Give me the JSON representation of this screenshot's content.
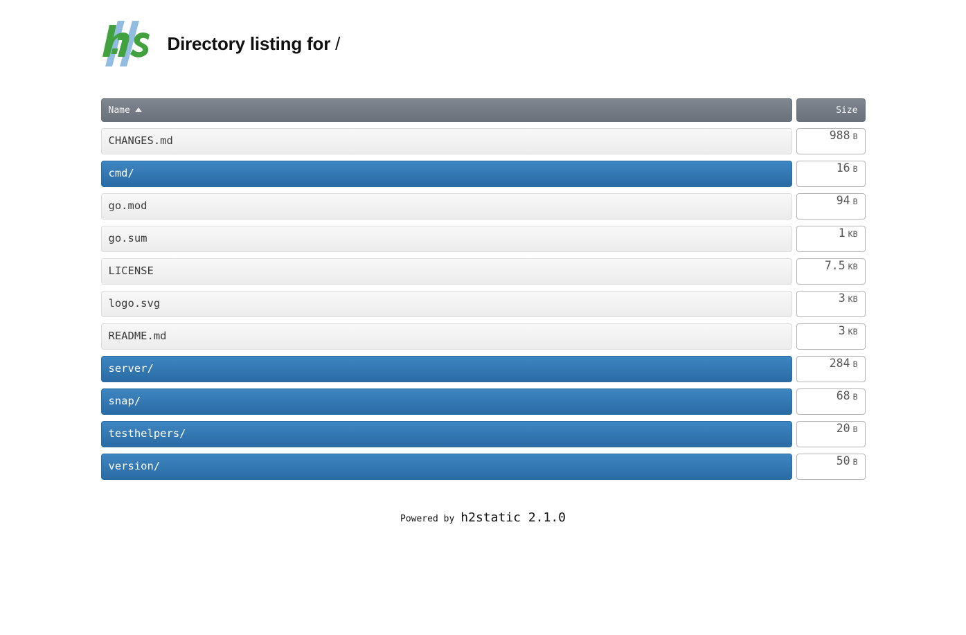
{
  "header": {
    "logo_alt": "h2static-logo",
    "logo_colors": {
      "green": "#41a13f",
      "blue": "#93bde0"
    },
    "title_prefix": "Directory listing for",
    "title_path": "/"
  },
  "table": {
    "columns": {
      "name": "Name",
      "size": "Size",
      "sort_indicator": "ascending"
    },
    "rows": [
      {
        "name": "CHANGES.md",
        "type": "file",
        "size_value": "988",
        "size_unit": "B"
      },
      {
        "name": "cmd/",
        "type": "dir",
        "size_value": "16",
        "size_unit": "B"
      },
      {
        "name": "go.mod",
        "type": "file",
        "size_value": "94",
        "size_unit": "B"
      },
      {
        "name": "go.sum",
        "type": "file",
        "size_value": "1",
        "size_unit": "KB"
      },
      {
        "name": "LICENSE",
        "type": "file",
        "size_value": "7.5",
        "size_unit": "KB"
      },
      {
        "name": "logo.svg",
        "type": "file",
        "size_value": "3",
        "size_unit": "KB"
      },
      {
        "name": "README.md",
        "type": "file",
        "size_value": "3",
        "size_unit": "KB"
      },
      {
        "name": "server/",
        "type": "dir",
        "size_value": "284",
        "size_unit": "B"
      },
      {
        "name": "snap/",
        "type": "dir",
        "size_value": "68",
        "size_unit": "B"
      },
      {
        "name": "testhelpers/",
        "type": "dir",
        "size_value": "20",
        "size_unit": "B"
      },
      {
        "name": "version/",
        "type": "dir",
        "size_value": "50",
        "size_unit": "B"
      }
    ]
  },
  "footer": {
    "label": "Powered by",
    "app": "h2static 2.1.0"
  },
  "colors": {
    "directory_row": "#3176b4",
    "header_row": "#767c86",
    "file_row": "#f2f2f2"
  }
}
